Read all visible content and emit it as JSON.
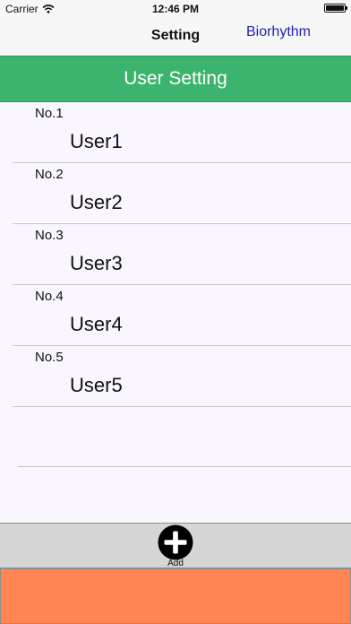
{
  "status_bar": {
    "carrier": "Carrier",
    "time": "12:46 PM",
    "battery_level": 1.0,
    "icons": [
      "wifi-icon",
      "battery-icon"
    ]
  },
  "nav_bar": {
    "title": "Setting",
    "right_button": "Biorhythm"
  },
  "header": {
    "title": "User Setting"
  },
  "users": [
    {
      "number": "No.1",
      "name": "User1"
    },
    {
      "number": "No.2",
      "name": "User2"
    },
    {
      "number": "No.3",
      "name": "User3"
    },
    {
      "number": "No.4",
      "name": "User4"
    },
    {
      "number": "No.5",
      "name": "User5"
    }
  ],
  "toolbar": {
    "add_label": "Add",
    "add_icon": "plus-circle-icon"
  },
  "colors": {
    "header_green": "#3cb46e",
    "link_blue": "#2222bb",
    "bottom_orange": "#ff8652",
    "toolbar_gray": "#d6d6d6"
  }
}
